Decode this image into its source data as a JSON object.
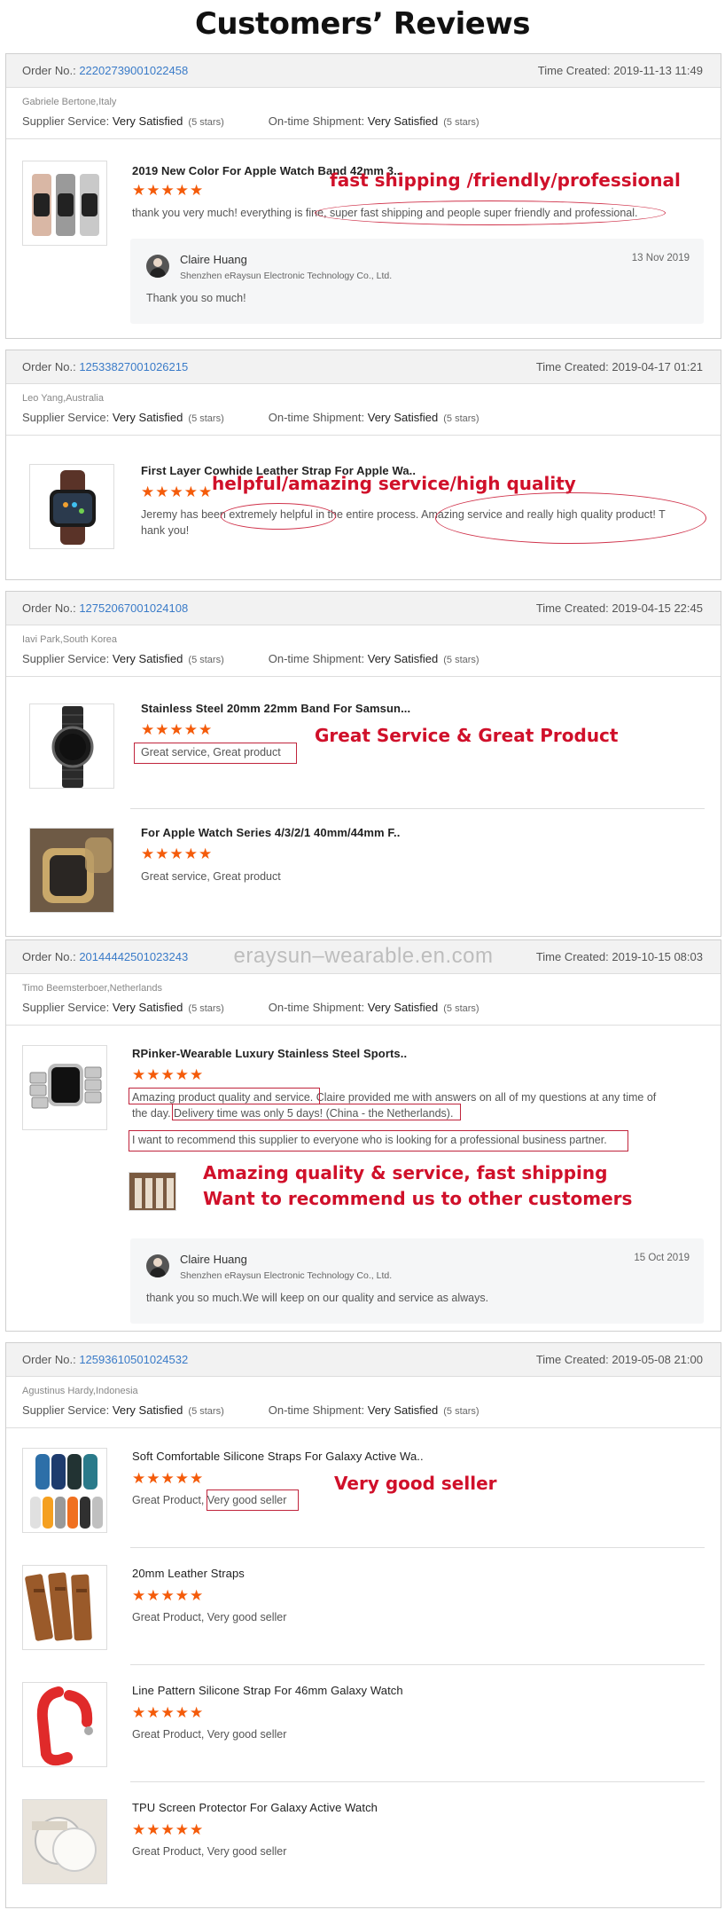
{
  "page_title": "Customers’ Reviews",
  "labels": {
    "order_no": "Order No.:",
    "time_created": "Time Created:",
    "supplier_service": "Supplier Service:",
    "ontime_shipment": "On-time Shipment:"
  },
  "orders": [
    {
      "order_no": "22202739001022458",
      "time": "2019-11-13 11:49",
      "buyer": "Gabriele Bertone,Italy",
      "supplier_rating": "Very Satisfied",
      "supplier_stars": "(5 stars)",
      "shipment_rating": "Very Satisfied",
      "shipment_stars": "(5 stars)",
      "items": [
        {
          "title": "2019 New Color For Apple Watch Band 42mm 3..",
          "stars": "★★★★★",
          "review": "thank you very much! everything is fine, super fast shipping and people super friendly and professional."
        }
      ],
      "reply": {
        "name": "Claire Huang",
        "company": "Shenzhen eRaysun Electronic Technology Co., Ltd.",
        "date": "13 Nov 2019",
        "message": "Thank you so much!"
      },
      "annotation": "fast shipping /friendly/professional"
    },
    {
      "order_no": "12533827001026215",
      "time": "2019-04-17 01:21",
      "buyer": "Leo Yang,Australia",
      "supplier_rating": "Very Satisfied",
      "supplier_stars": "(5 stars)",
      "shipment_rating": "Very Satisfied",
      "shipment_stars": "(5 stars)",
      "items": [
        {
          "title": "First Layer Cowhide Leather Strap For Apple Wa..",
          "stars": "★★★★★",
          "review_line1": "Jeremy has been extremely helpful in the entire process. Amazing service and really high quality product! T",
          "review_line2": "hank you!"
        }
      ],
      "annotation": "helpful/amazing service/high quality"
    },
    {
      "order_no": "12752067001024108",
      "time": "2019-04-15 22:45",
      "buyer": "Iavi Park,South Korea",
      "supplier_rating": "Very Satisfied",
      "supplier_stars": "(5 stars)",
      "shipment_rating": "Very Satisfied",
      "shipment_stars": "(5 stars)",
      "items": [
        {
          "title": "Stainless Steel 20mm 22mm Band For Samsun...",
          "stars": "★★★★★",
          "review": "Great service, Great product"
        },
        {
          "title": "For Apple Watch Series 4/3/2/1 40mm/44mm F..",
          "stars": "★★★★★",
          "review": "Great service, Great product"
        }
      ],
      "annotation": "Great Service & Great Product"
    },
    {
      "order_no": "20144442501023243",
      "time": "2019-10-15 08:03",
      "buyer": "Timo Beemsterboer,Netherlands",
      "supplier_rating": "Very Satisfied",
      "supplier_stars": "(5 stars)",
      "shipment_rating": "Very Satisfied",
      "shipment_stars": "(5 stars)",
      "items": [
        {
          "title": "RPinker-Wearable Luxury Stainless Steel Sports..",
          "stars": "★★★★★",
          "review_line1": "Amazing product quality and service. Claire provided me with answers on all of my questions at any time of",
          "review_line2": "the day. Delivery time was only 5 days! (China - the Netherlands).",
          "review_line3": "I want to recommend this supplier to everyone who is looking for a professional business  partner."
        }
      ],
      "reply": {
        "name": "Claire Huang",
        "company": "Shenzhen eRaysun Electronic Technology Co., Ltd.",
        "date": "15 Oct 2019",
        "message": "thank you so much.We will keep on our quality and service as always."
      },
      "annotation_line1": "Amazing quality & service, fast shipping",
      "annotation_line2": "Want to recommend us to other customers"
    },
    {
      "order_no": "12593610501024532",
      "time": "2019-05-08 21:00",
      "buyer": "Agustinus Hardy,Indonesia",
      "supplier_rating": "Very Satisfied",
      "supplier_stars": "(5 stars)",
      "shipment_rating": "Very Satisfied",
      "shipment_stars": "(5 stars)",
      "items": [
        {
          "title": "Soft Comfortable Silicone Straps For Galaxy Active Wa..",
          "stars": "★★★★★",
          "review": "Great Product, Very good seller"
        },
        {
          "title": "20mm Leather Straps",
          "stars": "★★★★★",
          "review": "Great Product, Very good seller"
        },
        {
          "title": "Line Pattern Silicone Strap For 46mm Galaxy Watch",
          "stars": "★★★★★",
          "review": "Great Product, Very good seller"
        },
        {
          "title": "TPU Screen Protector For Galaxy Active Watch",
          "stars": "★★★★★",
          "review": "Great Product, Very good seller"
        }
      ],
      "annotation": "Very good seller"
    }
  ],
  "watermark": "eraysun–wearable.en.com",
  "colors": {
    "star": "#f45b0a",
    "annotation": "#d0102a",
    "order_link": "#3a7bc8"
  }
}
